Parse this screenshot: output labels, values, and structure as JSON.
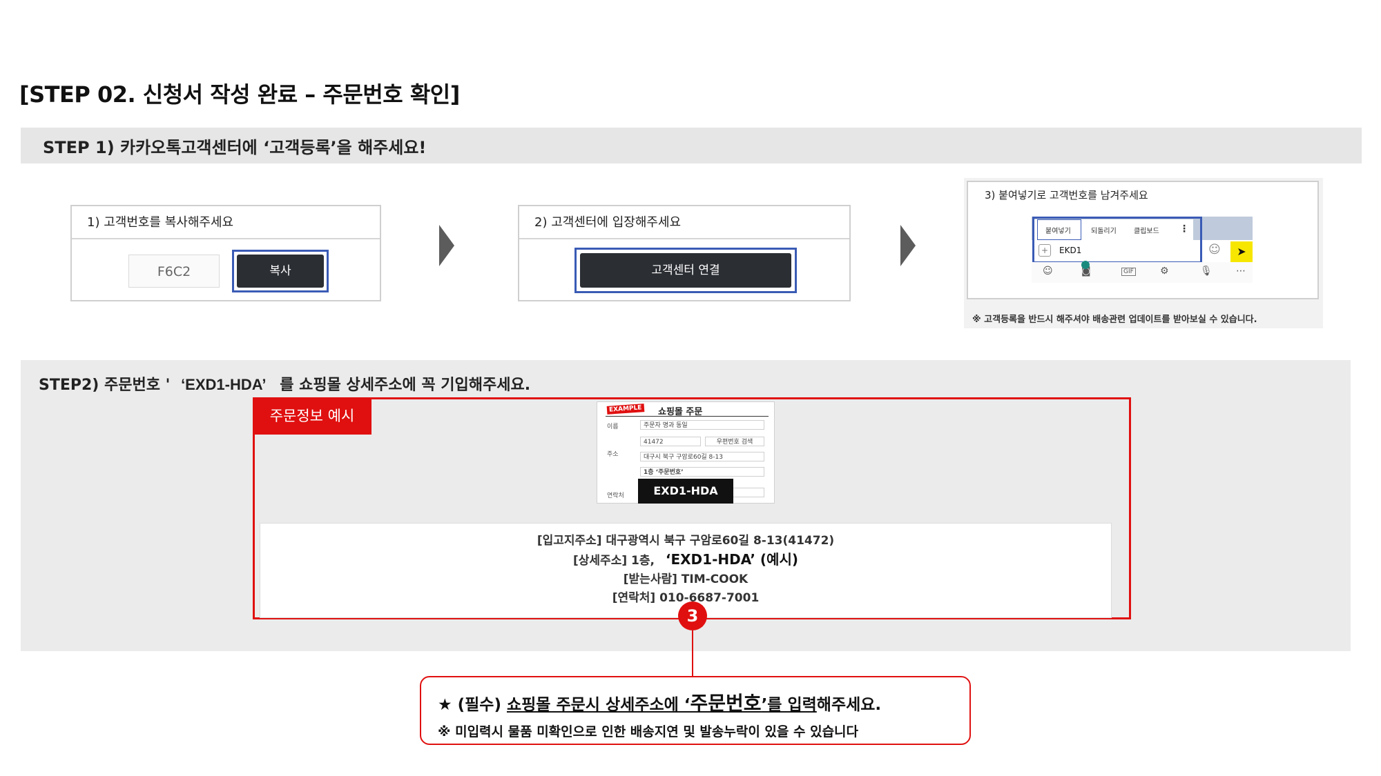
{
  "page": {
    "title": "[STEP 02. 신청서 작성 완료 – 주문번호 확인]"
  },
  "step1": {
    "heading": "STEP 1) 카카오톡고객센터에 ‘고객등록’을 해주세요!",
    "card1": {
      "title": "1) 고객번호를 복사해주세요",
      "code": "F6C2",
      "button": "복사"
    },
    "card2": {
      "title": "2) 고객센터에 입장해주세요",
      "button": "고객센터 연결"
    },
    "card3": {
      "title": "3) 붙여넣기로 고객번호를 남겨주세요",
      "menu": [
        "붙여넣기",
        "되돌리기",
        "클립보드"
      ],
      "input_value": "EKD1",
      "note": "※ 고객등록을 반드시 해주셔야 배송관련 업데이트를 받아보실 수 있습니다."
    }
  },
  "step2": {
    "heading_pre": "STEP2) 주문번호 '",
    "heading_code": "‘EXD1-HDA’",
    "heading_post": "를 쇼핑몰 상세주소에 꼭 기입해주세요.",
    "example_tag": "주문정보 예시",
    "form": {
      "badge": "EXAMPLE",
      "title": "쇼핑몰 주문",
      "name_label": "이름",
      "name_value": "주문자 명과 동일",
      "addr_label": "주소",
      "zip": "41472",
      "zip_button": "우편번호 검색",
      "addr1": "대구시 북구 구암로60길 8-13",
      "addr2": "1층 ‘주문번호’",
      "contact_label": "연락처",
      "order_code": "EXD1-HDA"
    },
    "address": {
      "line1": "[입고지주소] 대구광역시 북구 구암로60길 8-13(41472)",
      "line2_pre": "[상세주소] 1층,",
      "line2_code": "‘EXD1-HDA’ (예시)",
      "line3": "[받는사람] TIM-COOK",
      "line4": "[연락처] 010-6687-7001"
    },
    "badge_number": "3"
  },
  "notice": {
    "line1_star": "★ (필수) ",
    "line1_u1": "쇼핑몰 주문시 상세주소에 ‘",
    "line1_big": "주문번호",
    "line1_u2": "’를 입력",
    "line1_end": "해주세요.",
    "line2": "※ 미입력시 물품 미확인으로 인한 배송지연 및 발송누락이 있을 수 있습니다"
  },
  "colors": {
    "accent_red": "#e01010",
    "focus_blue": "#3a5bb5",
    "dark_button": "#2b2e33",
    "kakao_yellow": "#f7e600"
  }
}
